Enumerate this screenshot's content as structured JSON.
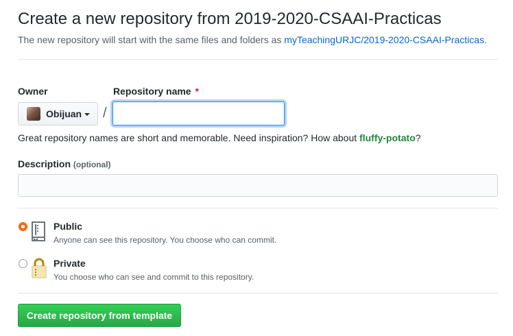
{
  "header": {
    "title": "Create a new repository from 2019-2020-CSAAI-Practicas",
    "subtitle_prefix": "The new repository will start with the same files and folders as ",
    "template_link": "myTeachingURJC/2019-2020-CSAAI-Practicas",
    "subtitle_suffix": "."
  },
  "form": {
    "owner_label": "Owner",
    "owner_value": "Obijuan",
    "separator": "/",
    "repo_name_label": "Repository name",
    "required_mark": "*",
    "repo_name_value": "",
    "hint_prefix": "Great repository names are short and memorable. Need inspiration? How about ",
    "hint_suggestion": "fluffy-potato",
    "hint_suffix": "?",
    "description_label": "Description",
    "description_optional": "(optional)",
    "description_value": ""
  },
  "visibility": {
    "selected": "public",
    "public": {
      "title": "Public",
      "note": "Anyone can see this repository. You choose who can commit.",
      "icon": "repo-book-icon"
    },
    "private": {
      "title": "Private",
      "note": "You choose who can see and commit to this repository.",
      "icon": "lock-icon"
    }
  },
  "actions": {
    "create_label": "Create repository from template"
  },
  "colors": {
    "link": "#0366d6",
    "suggestion": "#22863a",
    "primary": "#28a745",
    "focus": "#2188ff",
    "radio": "#f66a0a"
  }
}
